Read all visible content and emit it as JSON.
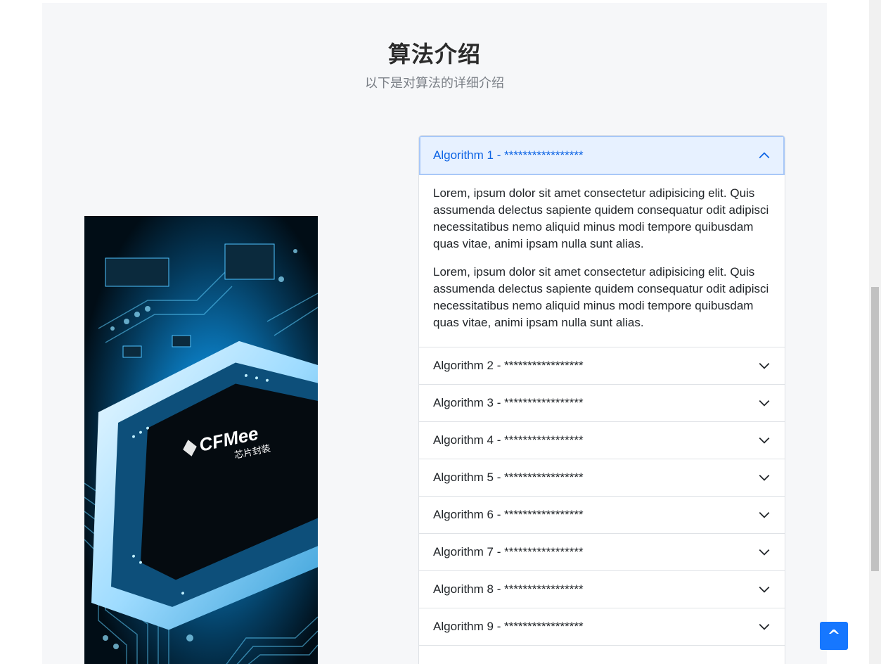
{
  "section": {
    "title": "算法介绍",
    "subtitle": "以下是对算法的详细介绍"
  },
  "image": {
    "chip_logo_text": "CFMee",
    "chip_sub_text": "芯片封装"
  },
  "accordion": {
    "items": [
      {
        "label": "Algorithm 1 - *****************",
        "open": true,
        "paragraphs": [
          "Lorem, ipsum dolor sit amet consectetur adipisicing elit. Quis assumenda delectus sapiente quidem consequatur odit adipisci necessitatibus nemo aliquid minus modi tempore quibusdam quas vitae, animi ipsam nulla sunt alias.",
          "Lorem, ipsum dolor sit amet consectetur adipisicing elit. Quis assumenda delectus sapiente quidem consequatur odit adipisci necessitatibus nemo aliquid minus modi tempore quibusdam quas vitae, animi ipsam nulla sunt alias."
        ]
      },
      {
        "label": "Algorithm 2 - *****************",
        "open": false
      },
      {
        "label": "Algorithm 3 - *****************",
        "open": false
      },
      {
        "label": "Algorithm 4 - *****************",
        "open": false
      },
      {
        "label": "Algorithm 5 - *****************",
        "open": false
      },
      {
        "label": "Algorithm 6 - *****************",
        "open": false
      },
      {
        "label": "Algorithm 7 - *****************",
        "open": false
      },
      {
        "label": "Algorithm 8 - *****************",
        "open": false
      },
      {
        "label": "Algorithm 9 - *****************",
        "open": false
      }
    ]
  },
  "back_to_top": {
    "label": "^"
  },
  "colors": {
    "accent": "#1677ff",
    "open_header_bg": "#e7f1ff",
    "open_header_text": "#0c63e4",
    "section_bg": "#f6f7f9"
  }
}
